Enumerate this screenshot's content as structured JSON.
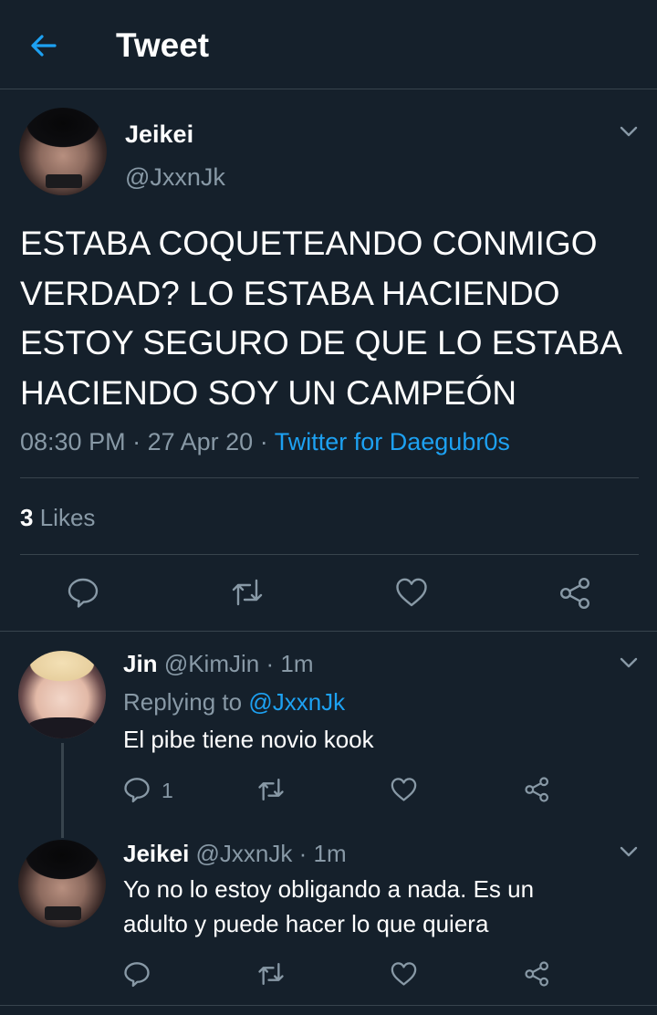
{
  "header": {
    "title": "Tweet"
  },
  "main_tweet": {
    "display_name": "Jeikei",
    "handle": "@JxxnJk",
    "text": "ESTABA COQUETEANDO CONMIGO\nVERDAD? LO ESTABA HACIENDO\nESTOY SEGURO DE QUE LO ESTABA\nHACIENDO SOY UN CAMPEÓN",
    "time": "08:30 PM",
    "date": "27 Apr 20",
    "separator": "·",
    "source": "Twitter for Daegubr0s",
    "likes_count": "3",
    "likes_label": "Likes"
  },
  "replies": [
    {
      "display_name": "Jin",
      "handle": "@KimJin",
      "separator": "·",
      "time": "1m",
      "replying_to_label": "Replying to",
      "replying_to_handle": "@JxxnJk",
      "text": "El pibe tiene novio kook",
      "reply_count": "1"
    },
    {
      "display_name": "Jeikei",
      "handle": "@JxxnJk",
      "separator": "·",
      "time": "1m",
      "text": "Yo no lo estoy obligando a nada. Es un\nadulto y puede hacer lo que quiera"
    }
  ],
  "icons": {
    "back": "arrow-left-icon",
    "more": "chevron-down-icon",
    "reply": "reply-icon",
    "retweet": "retweet-icon",
    "like": "heart-icon",
    "share": "share-icon"
  },
  "colors": {
    "background": "#15202b",
    "accent": "#1da1f2",
    "muted_text": "#8899a6",
    "divider": "#38444d"
  }
}
